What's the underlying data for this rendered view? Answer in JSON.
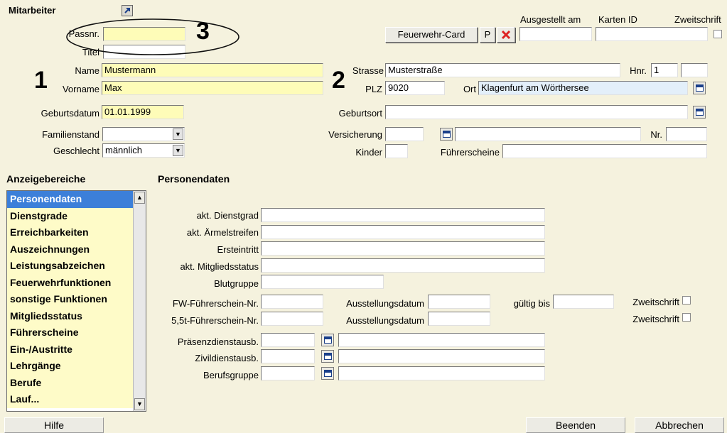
{
  "section": {
    "title": "Mitarbeiter",
    "pin_icon": "pin-icon"
  },
  "personal": {
    "passnr_label": "Passnr.",
    "passnr_value": "",
    "titel_label": "Titel",
    "titel_value": "",
    "name_label": "Name",
    "name_value": "Mustermann",
    "vorname_label": "Vorname",
    "vorname_value": "Max",
    "geburtsdatum_label": "Geburtsdatum",
    "geburtsdatum_value": "01.01.1999",
    "familienstand_label": "Familienstand",
    "familienstand_value": "",
    "geschlecht_label": "Geschlecht",
    "geschlecht_value": "männlich"
  },
  "card": {
    "ausgestellt_label": "Ausgestellt am",
    "karten_id_label": "Karten ID",
    "zweitschrift_label": "Zweitschrift",
    "feuerwehr_card_label": "Feuerwehr-Card",
    "p_label": "P",
    "ausgestellt_value": "",
    "karten_id_value": ""
  },
  "address": {
    "strasse_label": "Strasse",
    "strasse_value": "Musterstraße",
    "hnr_label": "Hnr.",
    "hnr_value": "1",
    "hnr2_value": "",
    "plz_label": "PLZ",
    "plz_value": "9020",
    "ort_label": "Ort",
    "ort_value": "Klagenfurt am Wörthersee",
    "geburtsort_label": "Geburtsort",
    "geburtsort_value": "",
    "versicherung_label": "Versicherung",
    "versicherung_value": "",
    "versicherung_name": "",
    "nr_label": "Nr.",
    "nr_value": "",
    "kinder_label": "Kinder",
    "kinder_value": "",
    "fuehrerscheine_label": "Führerscheine",
    "fuehrerscheine_value": ""
  },
  "annotations": {
    "one": "1",
    "two": "2",
    "three": "3"
  },
  "sidebar": {
    "title": "Anzeigebereiche",
    "items": [
      "Personendaten",
      "Dienstgrade",
      "Erreichbarkeiten",
      "Auszeichnungen",
      "Leistungsabzeichen",
      "Feuerwehrfunktionen",
      "sonstige Funktionen",
      "Mitgliedsstatus",
      "Führerscheine",
      "Ein-/Austritte",
      "Lehrgänge",
      "Berufe",
      "Lauf..."
    ],
    "selected_index": 0
  },
  "panel": {
    "title": "Personendaten",
    "dienstgrad_label": "akt. Dienstgrad",
    "aermelstreifen_label": "akt. Ärmelstreifen",
    "ersteintritt_label": "Ersteintritt",
    "mitgliedsstatus_label": "akt. Mitgliedsstatus",
    "blutgruppe_label": "Blutgruppe",
    "fw_fs_label": "FW-Führerschein-Nr.",
    "ausstellungsdatum1_label": "Ausstellungsdatum",
    "gueltig_bis_label": "gültig bis",
    "zweitschrift1_label": "Zweitschrift",
    "fs55_label": "5,5t-Führerschein-Nr.",
    "ausstellungsdatum2_label": "Ausstellungsdatum",
    "zweitschrift2_label": "Zweitschrift",
    "praesenz_label": "Präsenzdienstausb.",
    "zivil_label": "Zivildienstausb.",
    "beruf_label": "Berufsgruppe"
  },
  "footer": {
    "hilfe": "Hilfe",
    "beenden": "Beenden",
    "abbrechen": "Abbrechen"
  }
}
